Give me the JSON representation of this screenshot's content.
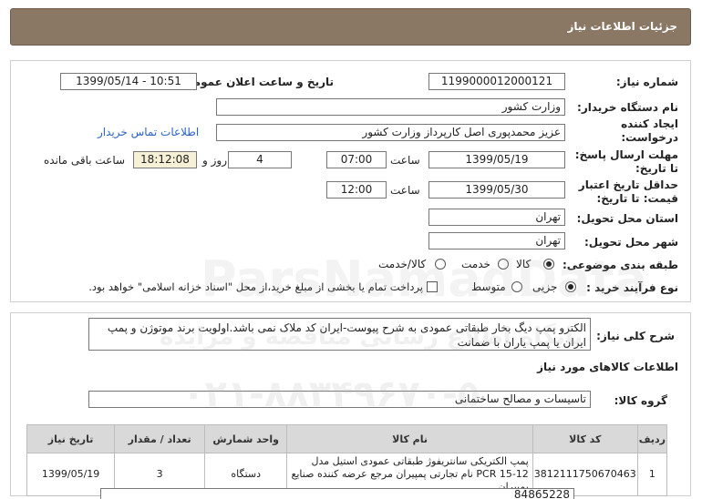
{
  "header": {
    "title": "جزئیات اطلاعات نیاز"
  },
  "form": {
    "need_number_label": "شماره نیاز:",
    "need_number": "1199000012000121",
    "announce_label": "تاریخ و ساعت اعلان عمومی:",
    "announce_value": "1399/05/14 - 10:51",
    "buyer_org_label": "نام دستگاه خریدار:",
    "buyer_org": "وزارت کشور",
    "creator_label_1": "ایجاد کننده",
    "creator_label_2": "درخواست:",
    "creator": "عزیز محمدپوری اصل کارپرداز وزارت کشور",
    "contact_link": "اطلاعات تماس خریدار",
    "deadline_label_1": "مهلت ارسال پاسخ:",
    "deadline_label_2": "تا تاریخ:",
    "deadline_date": "1399/05/19",
    "time_label": "ساعت",
    "deadline_time": "07:00",
    "days_value": "4",
    "days_label": "روز و",
    "remaining_time": "18:12:08",
    "remaining_label": "ساعت باقی مانده",
    "validity_label_1": "حداقل تاریخ اعتبار",
    "validity_label_2": "قیمت: تا تاریخ:",
    "validity_date": "1399/05/30",
    "validity_time": "12:00",
    "province_label": "استان محل تحویل:",
    "province": "تهران",
    "city_label": "شهر محل تحویل:",
    "city": "تهران",
    "category_label": "طبقه بندی موضوعی:",
    "category_options": [
      "کالا",
      "خدمت",
      "کالا/خدمت"
    ],
    "process_label": "نوع فرآیند خرید :",
    "process_options": [
      "جزیی",
      "متوسط"
    ],
    "payment_note": "پرداخت تمام یا بخشی از مبلغ خرید،از محل \"اسناد خزانه اسلامی\" خواهد بود."
  },
  "details": {
    "desc_label": "شرح کلی نیاز:",
    "desc_text": "الکترو پمپ دیگ بخار طبقاتی عمودی به شرح پیوست-ایران کد ملاک نمی باشد.اولویت برند موتوژن و پمپ ایران یا پمپ یاران با ضمانت",
    "goods_info_title": "اطلاعات کالاهای مورد نیاز",
    "group_label": "گروه کالا:",
    "group_value": "تاسیسات و مصالح ساختمانی"
  },
  "table": {
    "headers": [
      "ردیف",
      "کد کالا",
      "نام کالا",
      "واحد شمارش",
      "تعداد / مقدار",
      "تاریخ نیاز"
    ],
    "rows": [
      [
        "1",
        "3812111750670463",
        "پمپ الکتریکی سانتریفوژ طبقاتی عمودی استیل مدل PCR 15-12 نام تجارتی پمپیران مرجع عرضه کننده صنایع پمپیران",
        "دستگاه",
        "3",
        "1399/05/19"
      ]
    ]
  },
  "watermark": {
    "brand": "ParsNamadData",
    "line1": "پایگاه اطلاع رسانی مناقصه و مزایده",
    "phone": "۰۲۱-۸۸۳۴۹۶۷۰-۵"
  },
  "footer_partial": "84865228"
}
